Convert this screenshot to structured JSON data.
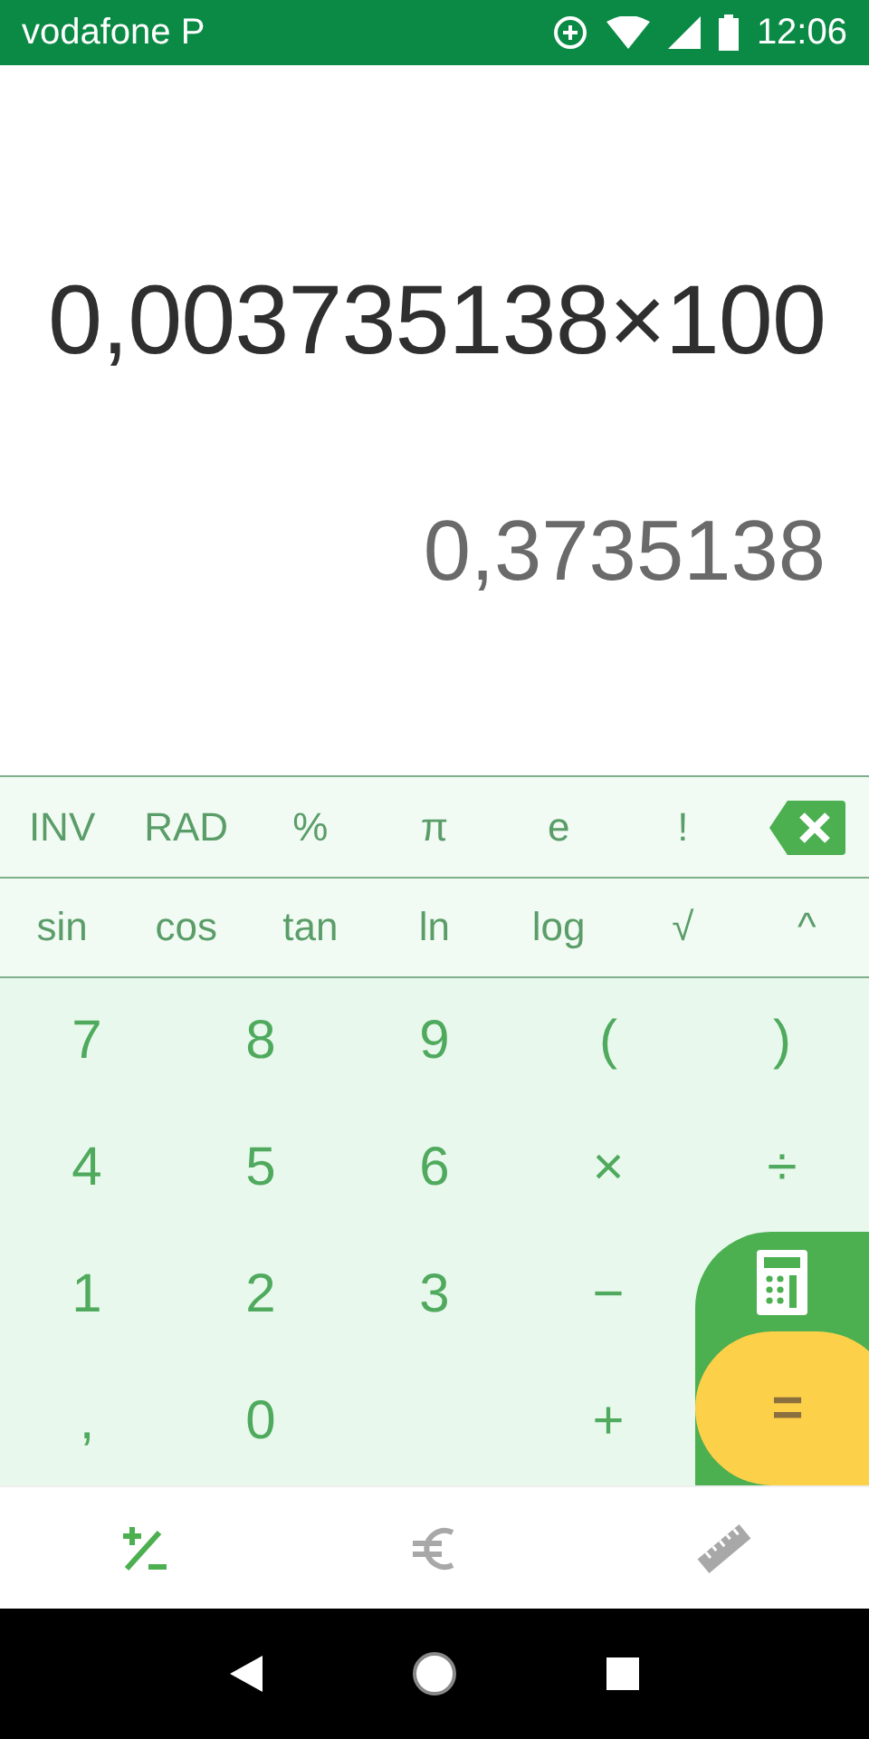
{
  "status_bar": {
    "carrier": "vodafone P",
    "time": "12:06"
  },
  "display": {
    "expression": "0,003735138×100",
    "result": "0,3735138"
  },
  "function_rows": [
    [
      "INV",
      "RAD",
      "%",
      "π",
      "e",
      "!"
    ],
    [
      "sin",
      "cos",
      "tan",
      "ln",
      "log",
      "√",
      "^"
    ]
  ],
  "keypad": {
    "rows": [
      [
        {
          "label": "7"
        },
        {
          "label": "8"
        },
        {
          "label": "9"
        },
        {
          "label": "("
        },
        {
          "label": ")"
        }
      ],
      [
        {
          "label": "4"
        },
        {
          "label": "5"
        },
        {
          "label": "6"
        },
        {
          "label": "×"
        },
        {
          "label": "÷"
        }
      ],
      [
        {
          "label": "1"
        },
        {
          "label": "2"
        },
        {
          "label": "3"
        },
        {
          "label": "−"
        }
      ],
      [
        {
          "label": ","
        },
        {
          "label": "0"
        },
        null,
        {
          "label": "+"
        }
      ]
    ],
    "equals": "="
  },
  "bottom_tabs": [
    {
      "kind": "calculator",
      "selected": true
    },
    {
      "kind": "currency",
      "selected": false
    },
    {
      "kind": "units",
      "selected": false
    }
  ]
}
